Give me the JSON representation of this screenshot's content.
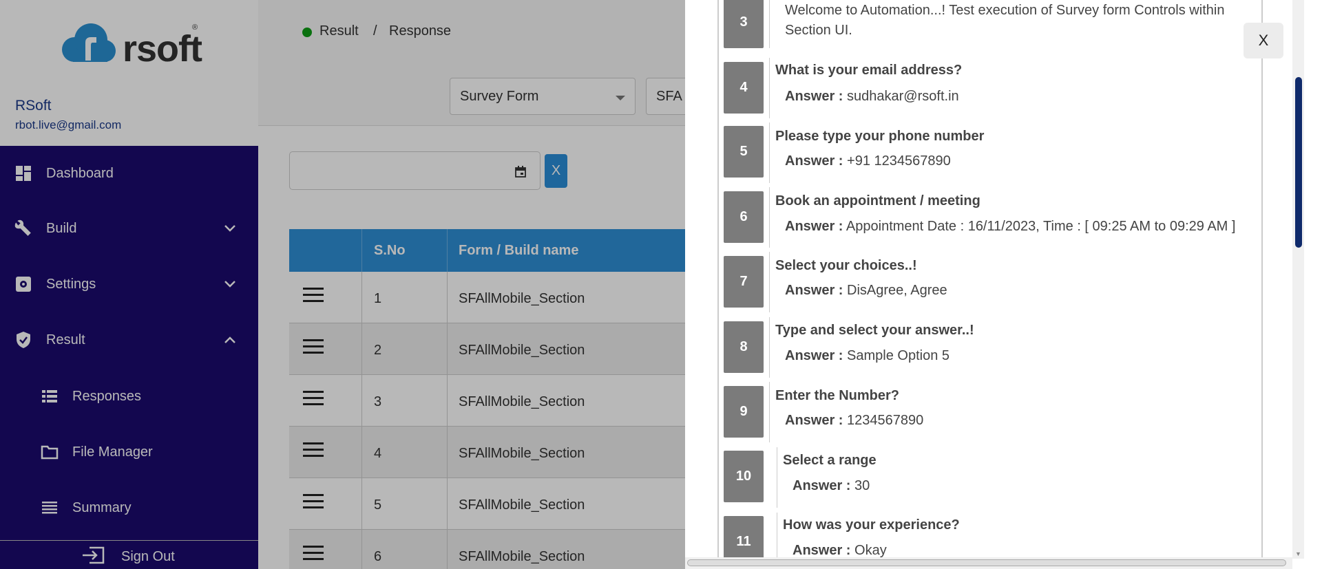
{
  "sidebar": {
    "logo_text": "rsoft",
    "logo_reg": "®",
    "user_name": "RSoft",
    "user_email": "rbot.live@gmail.com",
    "items": [
      {
        "label": "Dashboard"
      },
      {
        "label": "Build"
      },
      {
        "label": "Settings"
      },
      {
        "label": "Result"
      },
      {
        "label": "Responses"
      },
      {
        "label": "File Manager"
      },
      {
        "label": "Summary"
      }
    ],
    "signout_label": "Sign Out"
  },
  "breadcrumb": {
    "first": "Result",
    "sep": "/",
    "second": "Response"
  },
  "filters": {
    "form_select": "Survey Form",
    "build_select": "SFA",
    "clear_label": "X"
  },
  "table": {
    "headers": [
      "",
      "S.No",
      "Form / Build name"
    ],
    "rows": [
      {
        "sno": "1",
        "name": "SFAllMobile_Section"
      },
      {
        "sno": "2",
        "name": "SFAllMobile_Section"
      },
      {
        "sno": "3",
        "name": "SFAllMobile_Section"
      },
      {
        "sno": "4",
        "name": "SFAllMobile_Section"
      },
      {
        "sno": "5",
        "name": "SFAllMobile_Section"
      },
      {
        "sno": "6",
        "name": "SFAllMobile_Section"
      }
    ]
  },
  "modal": {
    "close_label": "X",
    "answer_label": "Answer :",
    "items": [
      {
        "num": "3",
        "text": "Welcome to Automation...! Test execution of Survey form Controls within Section UI."
      },
      {
        "num": "4",
        "title": "What is your email address?",
        "answer": "sudhakar@rsoft.in"
      },
      {
        "num": "5",
        "title": "Please type your phone number",
        "answer": "+91 1234567890"
      },
      {
        "num": "6",
        "title": "Book an appointment / meeting",
        "answer": "Appointment Date : 16/11/2023, Time : [ 09:25 AM to 09:29 AM ]"
      },
      {
        "num": "7",
        "title": "Select your choices..!",
        "answer": "DisAgree, Agree"
      },
      {
        "num": "8",
        "title": "Type and select your answer..!",
        "answer": "Sample Option 5"
      },
      {
        "num": "9",
        "title": "Enter the Number?",
        "answer": "1234567890"
      },
      {
        "num": "10",
        "title": "Select a range",
        "answer": "30"
      },
      {
        "num": "11",
        "title": "How was your experience?",
        "answer": "Okay"
      }
    ]
  }
}
